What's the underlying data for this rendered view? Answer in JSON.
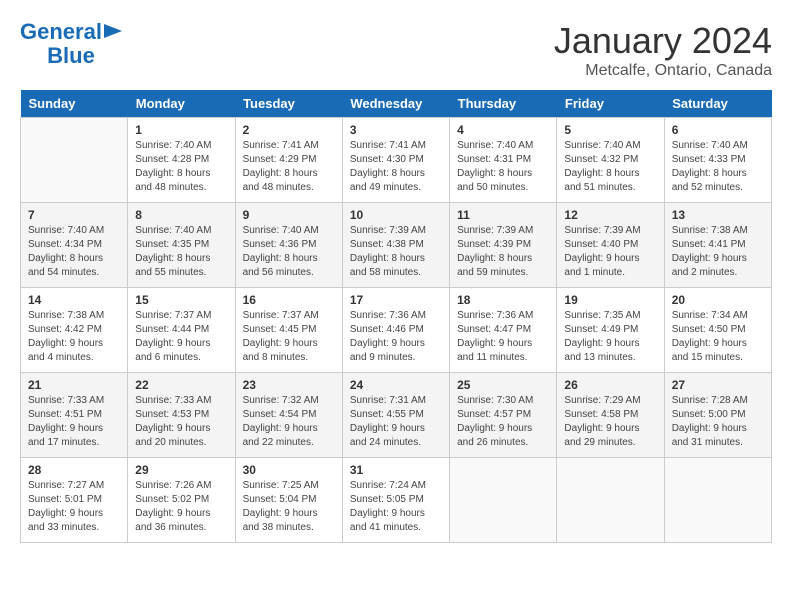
{
  "header": {
    "logo_line1": "General",
    "logo_line2": "Blue",
    "month": "January 2024",
    "location": "Metcalfe, Ontario, Canada"
  },
  "days_of_week": [
    "Sunday",
    "Monday",
    "Tuesday",
    "Wednesday",
    "Thursday",
    "Friday",
    "Saturday"
  ],
  "weeks": [
    [
      {
        "day": "",
        "sunrise": "",
        "sunset": "",
        "daylight": ""
      },
      {
        "day": "1",
        "sunrise": "Sunrise: 7:40 AM",
        "sunset": "Sunset: 4:28 PM",
        "daylight": "Daylight: 8 hours and 48 minutes."
      },
      {
        "day": "2",
        "sunrise": "Sunrise: 7:41 AM",
        "sunset": "Sunset: 4:29 PM",
        "daylight": "Daylight: 8 hours and 48 minutes."
      },
      {
        "day": "3",
        "sunrise": "Sunrise: 7:41 AM",
        "sunset": "Sunset: 4:30 PM",
        "daylight": "Daylight: 8 hours and 49 minutes."
      },
      {
        "day": "4",
        "sunrise": "Sunrise: 7:40 AM",
        "sunset": "Sunset: 4:31 PM",
        "daylight": "Daylight: 8 hours and 50 minutes."
      },
      {
        "day": "5",
        "sunrise": "Sunrise: 7:40 AM",
        "sunset": "Sunset: 4:32 PM",
        "daylight": "Daylight: 8 hours and 51 minutes."
      },
      {
        "day": "6",
        "sunrise": "Sunrise: 7:40 AM",
        "sunset": "Sunset: 4:33 PM",
        "daylight": "Daylight: 8 hours and 52 minutes."
      }
    ],
    [
      {
        "day": "7",
        "sunrise": "Sunrise: 7:40 AM",
        "sunset": "Sunset: 4:34 PM",
        "daylight": "Daylight: 8 hours and 54 minutes."
      },
      {
        "day": "8",
        "sunrise": "Sunrise: 7:40 AM",
        "sunset": "Sunset: 4:35 PM",
        "daylight": "Daylight: 8 hours and 55 minutes."
      },
      {
        "day": "9",
        "sunrise": "Sunrise: 7:40 AM",
        "sunset": "Sunset: 4:36 PM",
        "daylight": "Daylight: 8 hours and 56 minutes."
      },
      {
        "day": "10",
        "sunrise": "Sunrise: 7:39 AM",
        "sunset": "Sunset: 4:38 PM",
        "daylight": "Daylight: 8 hours and 58 minutes."
      },
      {
        "day": "11",
        "sunrise": "Sunrise: 7:39 AM",
        "sunset": "Sunset: 4:39 PM",
        "daylight": "Daylight: 8 hours and 59 minutes."
      },
      {
        "day": "12",
        "sunrise": "Sunrise: 7:39 AM",
        "sunset": "Sunset: 4:40 PM",
        "daylight": "Daylight: 9 hours and 1 minute."
      },
      {
        "day": "13",
        "sunrise": "Sunrise: 7:38 AM",
        "sunset": "Sunset: 4:41 PM",
        "daylight": "Daylight: 9 hours and 2 minutes."
      }
    ],
    [
      {
        "day": "14",
        "sunrise": "Sunrise: 7:38 AM",
        "sunset": "Sunset: 4:42 PM",
        "daylight": "Daylight: 9 hours and 4 minutes."
      },
      {
        "day": "15",
        "sunrise": "Sunrise: 7:37 AM",
        "sunset": "Sunset: 4:44 PM",
        "daylight": "Daylight: 9 hours and 6 minutes."
      },
      {
        "day": "16",
        "sunrise": "Sunrise: 7:37 AM",
        "sunset": "Sunset: 4:45 PM",
        "daylight": "Daylight: 9 hours and 8 minutes."
      },
      {
        "day": "17",
        "sunrise": "Sunrise: 7:36 AM",
        "sunset": "Sunset: 4:46 PM",
        "daylight": "Daylight: 9 hours and 9 minutes."
      },
      {
        "day": "18",
        "sunrise": "Sunrise: 7:36 AM",
        "sunset": "Sunset: 4:47 PM",
        "daylight": "Daylight: 9 hours and 11 minutes."
      },
      {
        "day": "19",
        "sunrise": "Sunrise: 7:35 AM",
        "sunset": "Sunset: 4:49 PM",
        "daylight": "Daylight: 9 hours and 13 minutes."
      },
      {
        "day": "20",
        "sunrise": "Sunrise: 7:34 AM",
        "sunset": "Sunset: 4:50 PM",
        "daylight": "Daylight: 9 hours and 15 minutes."
      }
    ],
    [
      {
        "day": "21",
        "sunrise": "Sunrise: 7:33 AM",
        "sunset": "Sunset: 4:51 PM",
        "daylight": "Daylight: 9 hours and 17 minutes."
      },
      {
        "day": "22",
        "sunrise": "Sunrise: 7:33 AM",
        "sunset": "Sunset: 4:53 PM",
        "daylight": "Daylight: 9 hours and 20 minutes."
      },
      {
        "day": "23",
        "sunrise": "Sunrise: 7:32 AM",
        "sunset": "Sunset: 4:54 PM",
        "daylight": "Daylight: 9 hours and 22 minutes."
      },
      {
        "day": "24",
        "sunrise": "Sunrise: 7:31 AM",
        "sunset": "Sunset: 4:55 PM",
        "daylight": "Daylight: 9 hours and 24 minutes."
      },
      {
        "day": "25",
        "sunrise": "Sunrise: 7:30 AM",
        "sunset": "Sunset: 4:57 PM",
        "daylight": "Daylight: 9 hours and 26 minutes."
      },
      {
        "day": "26",
        "sunrise": "Sunrise: 7:29 AM",
        "sunset": "Sunset: 4:58 PM",
        "daylight": "Daylight: 9 hours and 29 minutes."
      },
      {
        "day": "27",
        "sunrise": "Sunrise: 7:28 AM",
        "sunset": "Sunset: 5:00 PM",
        "daylight": "Daylight: 9 hours and 31 minutes."
      }
    ],
    [
      {
        "day": "28",
        "sunrise": "Sunrise: 7:27 AM",
        "sunset": "Sunset: 5:01 PM",
        "daylight": "Daylight: 9 hours and 33 minutes."
      },
      {
        "day": "29",
        "sunrise": "Sunrise: 7:26 AM",
        "sunset": "Sunset: 5:02 PM",
        "daylight": "Daylight: 9 hours and 36 minutes."
      },
      {
        "day": "30",
        "sunrise": "Sunrise: 7:25 AM",
        "sunset": "Sunset: 5:04 PM",
        "daylight": "Daylight: 9 hours and 38 minutes."
      },
      {
        "day": "31",
        "sunrise": "Sunrise: 7:24 AM",
        "sunset": "Sunset: 5:05 PM",
        "daylight": "Daylight: 9 hours and 41 minutes."
      },
      {
        "day": "",
        "sunrise": "",
        "sunset": "",
        "daylight": ""
      },
      {
        "day": "",
        "sunrise": "",
        "sunset": "",
        "daylight": ""
      },
      {
        "day": "",
        "sunrise": "",
        "sunset": "",
        "daylight": ""
      }
    ]
  ]
}
